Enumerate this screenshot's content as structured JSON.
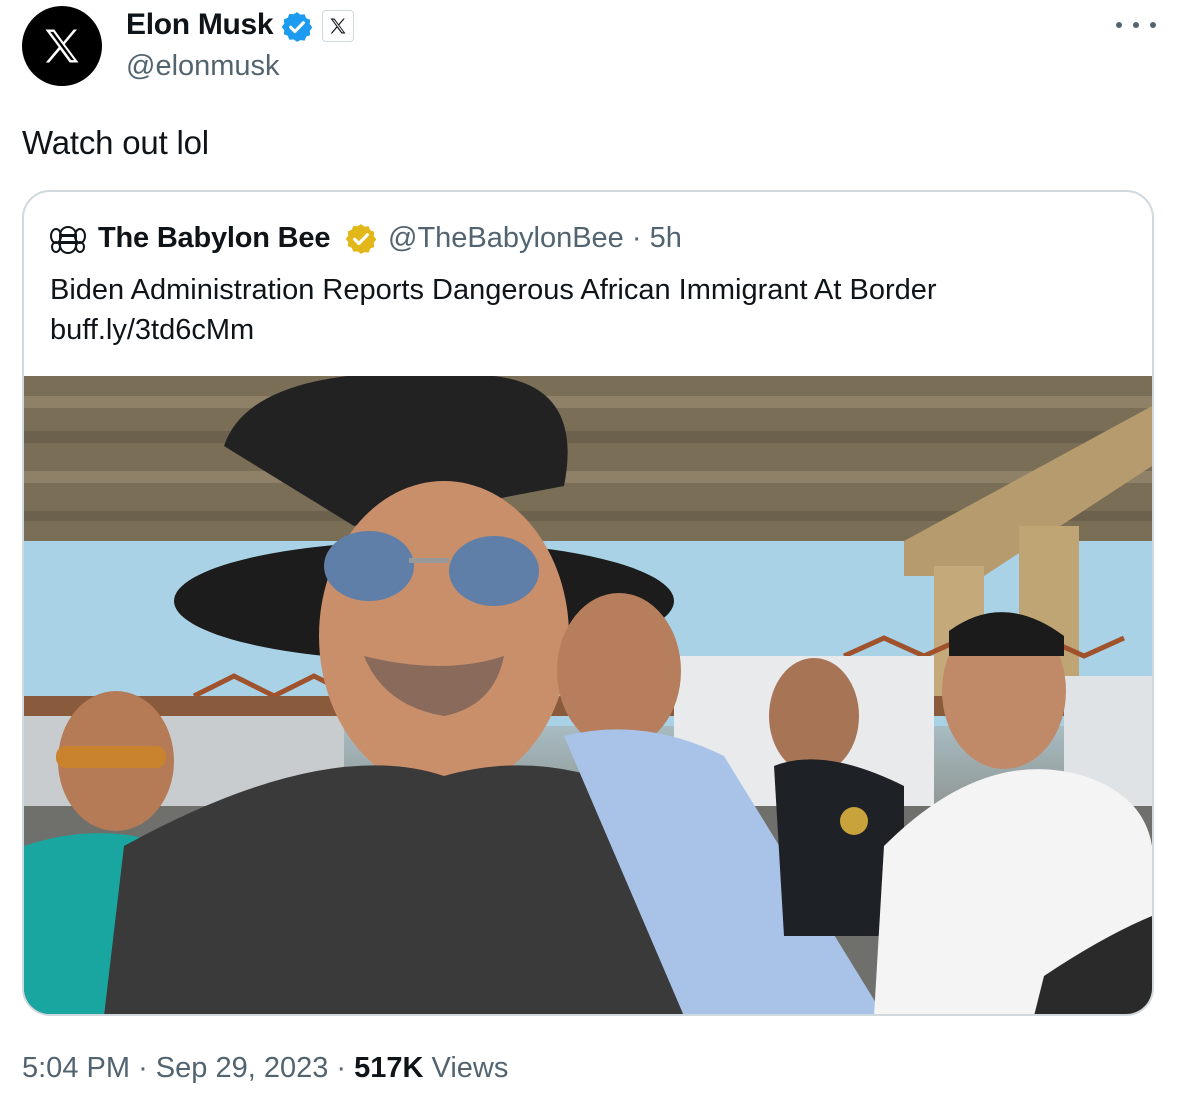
{
  "author": {
    "name": "Elon Musk",
    "handle": "@elonmusk",
    "avatar_icon": "x-logo-icon",
    "verified_color": "#1d9bf0"
  },
  "tweet": {
    "text": "Watch out lol"
  },
  "quoted": {
    "name": "The Babylon Bee",
    "handle": "@TheBabylonBee",
    "separator": "·",
    "age": "5h",
    "headline": "Biden Administration Reports Dangerous African Immigrant At Border",
    "link": "buff.ly/3td6cMm",
    "verified_color": "#e2b719"
  },
  "footer": {
    "time": "5:04 PM",
    "sep1": "·",
    "date": "Sep 29, 2023",
    "sep2": "·",
    "views_count": "517K",
    "views_label": "Views"
  }
}
